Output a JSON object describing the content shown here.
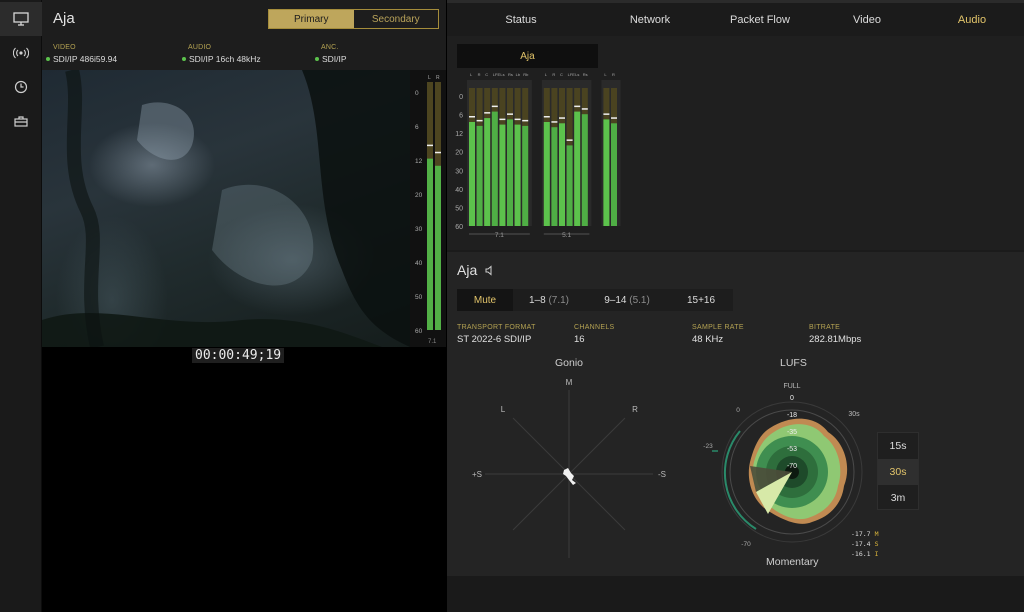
{
  "left": {
    "source_title": "Aja",
    "segment": {
      "primary": "Primary",
      "secondary": "Secondary"
    },
    "signals": [
      {
        "key": "VIDEO",
        "value": "SDI/IP 486i59.94"
      },
      {
        "key": "AUDIO",
        "value": "SDI/IP 16ch 48kHz"
      },
      {
        "key": "ANC.",
        "value": "SDI/IP"
      }
    ],
    "timecode": "00:00:49;19",
    "meter": {
      "header": [
        "L",
        "R"
      ],
      "scale": [
        "0",
        "6",
        "12",
        "20",
        "30",
        "40",
        "50",
        "60"
      ],
      "footer": "7.1",
      "levels": [
        0.72,
        0.69
      ]
    }
  },
  "tabs": [
    "Status",
    "Network",
    "Packet Flow",
    "Video",
    "Audio"
  ],
  "active_tab": "Audio",
  "upper": {
    "source_pill": "Aja",
    "scale": [
      "0",
      "6",
      "12",
      "20",
      "30",
      "40",
      "50",
      "60"
    ],
    "groups": [
      {
        "label": "7.1",
        "headers": [
          "L",
          "R",
          "C",
          "LFE",
          "Ls",
          "Rs",
          "Lb",
          "Rb"
        ],
        "levels": [
          0.8,
          0.77,
          0.83,
          0.88,
          0.78,
          0.82,
          0.78,
          0.77
        ]
      },
      {
        "label": "5.1",
        "headers": [
          "L",
          "R",
          "C",
          "LFE",
          "Ls",
          "Rs"
        ],
        "levels": [
          0.8,
          0.76,
          0.79,
          0.62,
          0.88,
          0.86
        ]
      },
      {
        "label": "",
        "headers": [
          "L",
          "R"
        ],
        "levels": [
          0.82,
          0.79
        ]
      }
    ]
  },
  "lower": {
    "title": "Aja",
    "channel_tabs": [
      {
        "label": "Mute",
        "sub": ""
      },
      {
        "label": "1–8",
        "sub": "(7.1)"
      },
      {
        "label": "9–14",
        "sub": "(5.1)"
      },
      {
        "label": "15+16",
        "sub": ""
      }
    ],
    "info": [
      {
        "key": "TRANSPORT FORMAT",
        "value": "ST 2022-6 SDI/IP"
      },
      {
        "key": "CHANNELS",
        "value": "16"
      },
      {
        "key": "SAMPLE RATE",
        "value": "48 KHz"
      },
      {
        "key": "BITRATE",
        "value": "282.81Mbps"
      }
    ],
    "gonio": {
      "title": "Gonio",
      "labels": {
        "m": "M",
        "l": "L",
        "r": "R",
        "ps": "+S",
        "ms": "-S"
      }
    },
    "lufs": {
      "title": "LUFS",
      "footer": "Momentary",
      "labels": {
        "full": "FULL",
        "zero": "0",
        "z2": "0",
        "n23": "-23",
        "n70": "-70",
        "t30": "30s"
      },
      "rings": [
        "0",
        "-18",
        "-35",
        "-53",
        "-70"
      ],
      "time_options": [
        "15s",
        "30s",
        "3m"
      ],
      "selected_time": "30s",
      "readouts": [
        {
          "value": "-17.7",
          "unit": "M"
        },
        {
          "value": "-17.4",
          "unit": "S"
        },
        {
          "value": "-16.1",
          "unit": "I"
        }
      ]
    }
  }
}
